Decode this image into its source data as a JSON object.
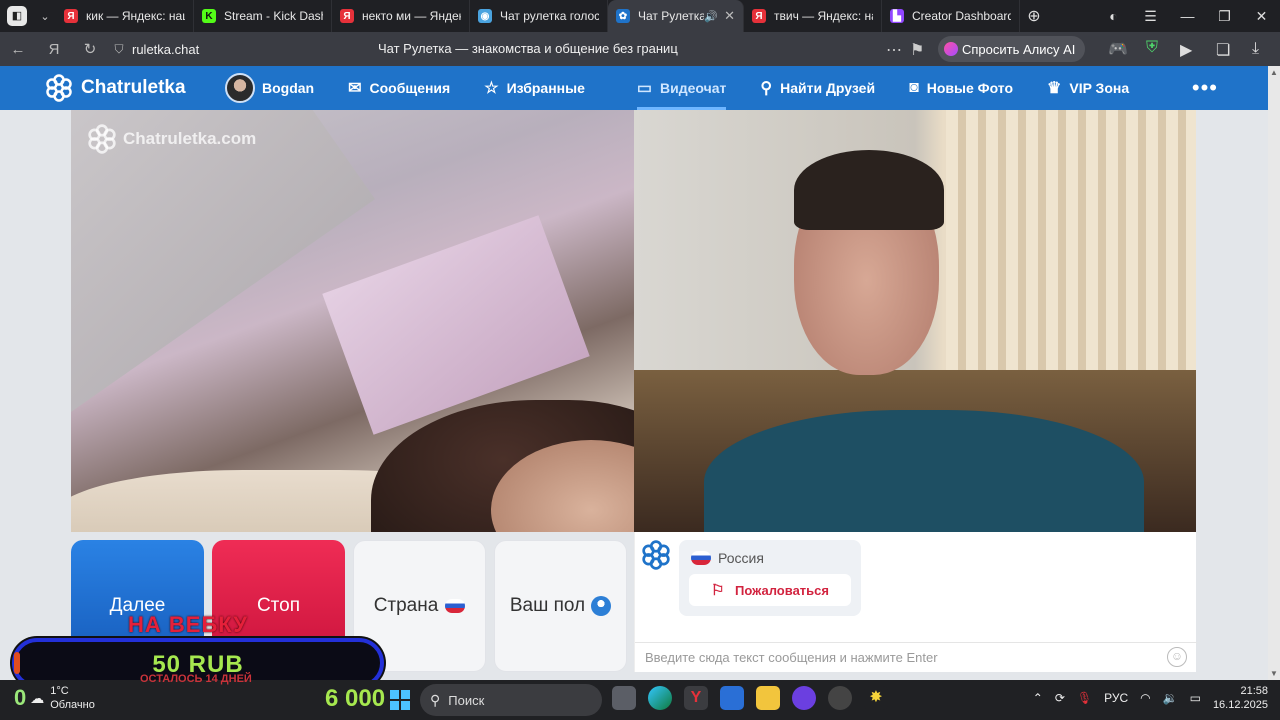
{
  "browser": {
    "tabs": [
      {
        "title": "кик — Яндекс: нашл",
        "favicon": "yandex-icon",
        "color": "#e6313a"
      },
      {
        "title": "Stream - Kick Dashb",
        "favicon": "kick-icon",
        "color": "#53fc18"
      },
      {
        "title": "некто ми — Яндекс:",
        "favicon": "yandex-icon",
        "color": "#e6313a"
      },
      {
        "title": "Чат рулетка голосо",
        "favicon": "chat-icon",
        "color": "#4aa3df"
      },
      {
        "title": "Чат Рулетка —",
        "favicon": "chatruletka-icon",
        "color": "#1f73c9",
        "active": true
      },
      {
        "title": "твич — Яндекс: наш",
        "favicon": "yandex-icon",
        "color": "#e6313a"
      },
      {
        "title": "Creator Dashboard",
        "favicon": "twitch-icon",
        "color": "#9146ff"
      }
    ],
    "url": "ruletka.chat",
    "page_title": "Чат Рулетка — знакомства и общение без границ",
    "alice_label": "Спросить Алису AI"
  },
  "site": {
    "logo_text": "Chatruletka",
    "nav": [
      {
        "label": "Bogdan",
        "icon": "avatar"
      },
      {
        "label": "Сообщения",
        "icon": "envelope-icon"
      },
      {
        "label": "Избранные",
        "icon": "star-icon"
      },
      {
        "label": "Видеочат",
        "icon": "camera-icon",
        "active": true
      },
      {
        "label": "Найти Друзей",
        "icon": "search-icon"
      },
      {
        "label": "Новые Фото",
        "icon": "photo-icon"
      },
      {
        "label": "VIP Зона",
        "icon": "crown-icon"
      }
    ],
    "more_label": "•••",
    "watermark": "Chatruletka.com"
  },
  "controls": {
    "next_label": "Далее",
    "stop_label": "Стоп",
    "country_label": "Страна",
    "gender_label": "Ваш пол"
  },
  "chat": {
    "country": "Россия",
    "report_label": "Пожаловаться",
    "input_placeholder": "Введите сюда текст сообщения и нажмите Enter"
  },
  "overlay": {
    "top_text": "НА ВЕБКУ",
    "promo_text": "50 RUB",
    "sub_text": "ОСТАЛОСЬ 14 ДНЕЙ",
    "counter_zero": "0",
    "money": "6 000"
  },
  "taskbar": {
    "weather_temp": "1°C",
    "weather_desc": "Облачно",
    "search_label": "Поиск",
    "lang": "РУС",
    "time": "21:58",
    "date": "16.12.2025"
  }
}
